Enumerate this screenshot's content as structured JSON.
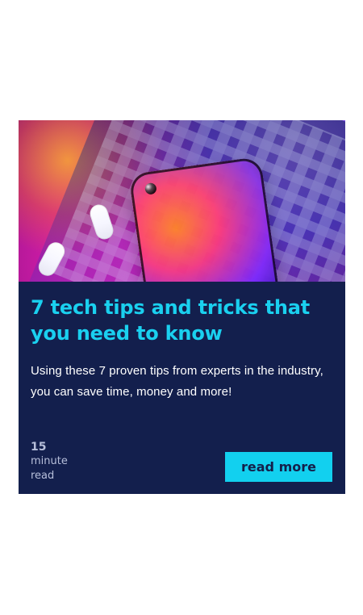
{
  "card": {
    "title": "7 tech tips and tricks that you need to know",
    "description": "Using these 7 proven tips from experts in the industry, you can save time, money and more!",
    "read_time": {
      "number": "15",
      "unit_line1": "minute",
      "unit_line2": "read"
    },
    "cta_label": "read more"
  },
  "colors": {
    "card_background": "#131f4d",
    "accent": "#12d0ef",
    "description_text": "#ffffff",
    "meta_text": "#b7bfda"
  }
}
